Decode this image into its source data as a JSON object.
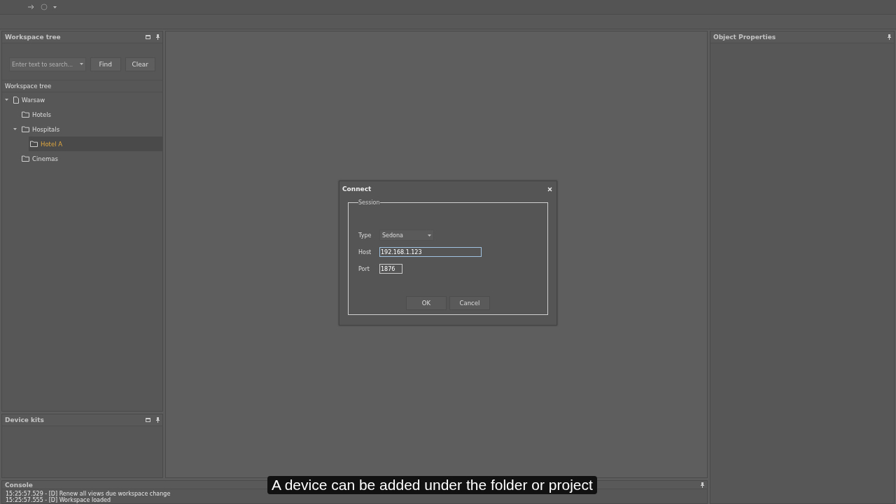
{
  "panels": {
    "workspace": {
      "title": "Workspace tree",
      "search": {
        "placeholder": "Enter text to search..."
      },
      "buttons": [
        "Find",
        "Clear"
      ],
      "tree_header": "Workspace tree"
    },
    "device_kits": {
      "title": "Device kits"
    },
    "object_properties": {
      "title": "Object Properties"
    },
    "console": {
      "title": "Console",
      "lines": [
        "15:25:57.529 - [D] Renew all views due workspace change",
        "15:25:57.555 - [D] Workspace loaded"
      ]
    }
  },
  "tree": [
    {
      "label": "Warsaw",
      "kind": "project",
      "expanded": true,
      "selected": false,
      "children": [
        {
          "label": "Hotels",
          "kind": "folder",
          "selected": false
        },
        {
          "label": "Hospitals",
          "kind": "folder",
          "expanded": true,
          "selected": false,
          "children": [
            {
              "label": "Hotel A",
              "kind": "folder",
              "selected": true
            }
          ]
        },
        {
          "label": "Cinemas",
          "kind": "folder",
          "selected": false
        }
      ]
    }
  ],
  "dialog": {
    "title": "Connect",
    "group": "Session",
    "type": {
      "label": "Type",
      "value": "Sedona"
    },
    "host": {
      "label": "Host",
      "value": "192.168.1.123"
    },
    "port": {
      "label": "Port",
      "value": "1876"
    },
    "buttons": [
      "OK",
      "Cancel"
    ]
  },
  "caption": "A device can be added under the folder or project"
}
